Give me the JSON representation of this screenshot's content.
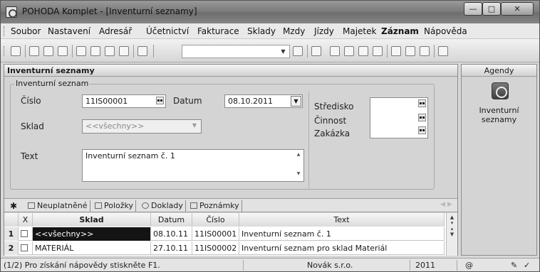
{
  "window": {
    "title": "POHODA Komplet - [Inventurní seznamy]",
    "min_glyph": "—",
    "max_glyph": "□",
    "close_glyph": "✕"
  },
  "menu": [
    "Soubor",
    "Nastavení",
    "Adresář",
    "Účetnictví",
    "Fakturace",
    "Sklady",
    "Mzdy",
    "Jízdy",
    "Majetek",
    "Záznam",
    "Nápověda"
  ],
  "panel": {
    "title": "Inventurní seznamy",
    "group_title": "Inventurní seznam",
    "at_icon": "@"
  },
  "form": {
    "cislo_label": "Číslo",
    "cislo_value": "11IS00001",
    "datum_label": "Datum",
    "datum_value": "08.10.2011",
    "sklad_label": "Sklad",
    "sklad_value": "<<všechny>>",
    "text_label": "Text",
    "text_value": "Inventurní seznam č. 1",
    "stredisko_label": "Středisko",
    "cinnost_label": "Činnost",
    "zakazka_label": "Zakázka"
  },
  "tabs": {
    "star": "✱",
    "items": [
      "Neuplatněné",
      "Položky",
      "Doklady",
      "Poznámky"
    ]
  },
  "table": {
    "headers": [
      "X",
      "Sklad",
      "Datum",
      "Číslo",
      "Text"
    ],
    "rows": [
      {
        "num": "1",
        "sklad": "<<všechny>>",
        "datum": "08.10.11",
        "cislo": "11IS00001",
        "text": "Inventurní seznam č. 1"
      },
      {
        "num": "2",
        "sklad": "MATERIÁL",
        "datum": "27.10.11",
        "cislo": "11IS00002",
        "text": "Inventurní seznam pro sklad Materiál"
      }
    ]
  },
  "right_pane": {
    "title": "Agendy",
    "item_label_1": "Inventurní",
    "item_label_2": "seznamy"
  },
  "status": {
    "help": "(1/2) Pro získání nápovědy stiskněte F1.",
    "company": "Novák s.r.o.",
    "year": "2011",
    "at": "@"
  }
}
